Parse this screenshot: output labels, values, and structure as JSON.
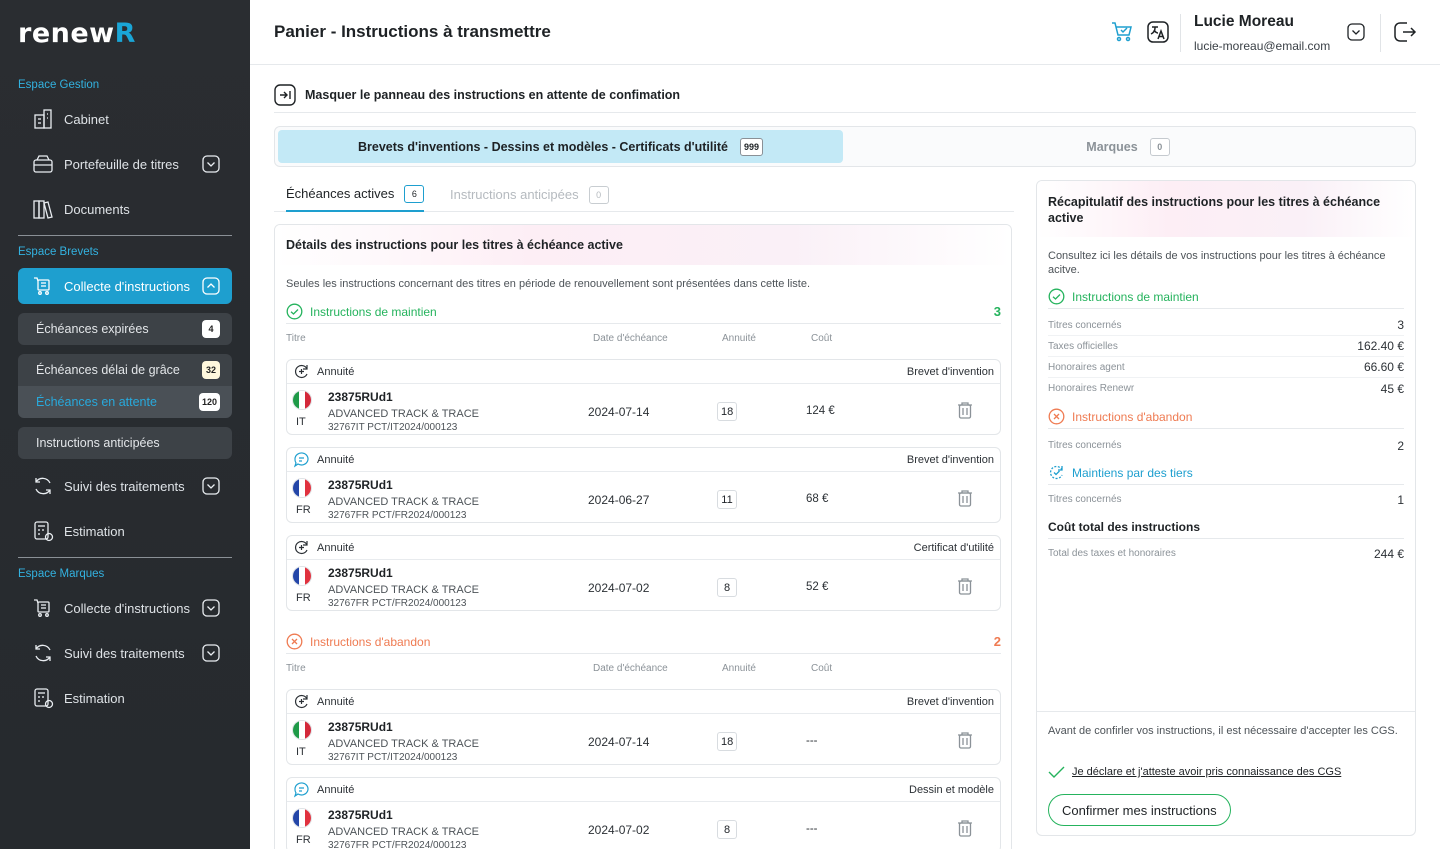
{
  "brand": {
    "logo_main": "renew",
    "logo_accent": "R"
  },
  "sidebar": {
    "gestion_label": "Espace Gestion",
    "gestion_items": [
      "Cabinet",
      "Portefeuille de titres",
      "Documents"
    ],
    "brevets_label": "Espace Brevets",
    "brevets_collecte": "Collecte d'instructions",
    "sub_items": [
      {
        "label": "Échéances expirées",
        "count": "4"
      },
      {
        "label": "Échéances délai de grâce",
        "count": "32"
      },
      {
        "label": "Échéances en attente",
        "count": "120"
      },
      {
        "label": "Instructions anticipées",
        "count": ""
      }
    ],
    "brevets_suivi": "Suivi des traitements",
    "brevets_estimation": "Estimation",
    "marques_label": "Espace Marques",
    "marques_items": [
      "Collecte d'instructions",
      "Suivi des traitements",
      "Estimation"
    ]
  },
  "header": {
    "title": "Panier - Instructions à transmettre",
    "user_name": "Lucie Moreau",
    "user_email": "lucie-moreau@email.com"
  },
  "toggle": {
    "label": "Masquer le panneau des instructions en attente de confimation"
  },
  "segments": [
    {
      "label": "Brevets d'inventions - Dessins et modèles - Certificats d'utilité",
      "count": "999"
    },
    {
      "label": "Marques",
      "count": "0"
    }
  ],
  "tabs": [
    {
      "label": "Échéances actives",
      "count": "6"
    },
    {
      "label": "Instructions anticipées",
      "count": "0"
    }
  ],
  "details": {
    "title": "Détails des instructions pour les titres à échéance active",
    "note": "Seules les instructions concernant des titres en période de renouvellement sont présentées dans cette liste.",
    "columns": {
      "titre": "Titre",
      "date": "Date d'échéance",
      "annuite": "Annuité",
      "cout": "Coût"
    },
    "maintien": {
      "title": "Instructions de maintien",
      "count": "3",
      "items": [
        {
          "annuity": "Annuité",
          "type": "Brevet d'invention",
          "ref": "23875RUd1",
          "desc": "ADVANCED TRACK & TRACE",
          "num": "32767IT   PCT/IT2024/000123",
          "cc": "IT",
          "date": "2024-07-14",
          "annuite": "18",
          "cost": "124 €"
        },
        {
          "annuity": "Annuité",
          "type": "Brevet d'invention",
          "ref": "23875RUd1",
          "desc": "ADVANCED TRACK & TRACE",
          "num": "32767FR   PCT/FR2024/000123",
          "cc": "FR",
          "date": "2024-06-27",
          "annuite": "11",
          "cost": "68 €"
        },
        {
          "annuity": "Annuité",
          "type": "Certificat d'utilité",
          "ref": "23875RUd1",
          "desc": "ADVANCED TRACK & TRACE",
          "num": "32767FR   PCT/FR2024/000123",
          "cc": "FR",
          "date": "2024-07-02",
          "annuite": "8",
          "cost": "52 €"
        }
      ]
    },
    "abandon": {
      "title": "Instructions d'abandon",
      "count": "2",
      "items": [
        {
          "annuity": "Annuité",
          "type": "Brevet d'invention",
          "ref": "23875RUd1",
          "desc": "ADVANCED TRACK & TRACE",
          "num": "32767IT   PCT/IT2024/000123",
          "cc": "IT",
          "date": "2024-07-14",
          "annuite": "18",
          "cost": "---"
        },
        {
          "annuity": "Annuité",
          "type": "Dessin et modèle",
          "ref": "23875RUd1",
          "desc": "ADVANCED TRACK & TRACE",
          "num": "32767FR   PCT/FR2024/000123",
          "cc": "FR",
          "date": "2024-07-02",
          "annuite": "8",
          "cost": "---"
        }
      ]
    }
  },
  "summary": {
    "title": "Récapitulatif des instructions pour les titres à échéance active",
    "note": "Consultez ici les détails de vos instructions pour les titres à échéance acitve.",
    "maintien_title": "Instructions de maintien",
    "maintien_rows": [
      {
        "k": "Titres concernés",
        "v": "3"
      },
      {
        "k": "Taxes officielles",
        "v": "162.40 €"
      },
      {
        "k": "Honoraires agent",
        "v": "66.60 €"
      },
      {
        "k": "Honoraires Renewr",
        "v": "45 €"
      }
    ],
    "abandon_title": "Instructions d'abandon",
    "abandon_rows": [
      {
        "k": "Titres concernés",
        "v": "2"
      }
    ],
    "tiers_title": "Maintiens par des tiers",
    "tiers_rows": [
      {
        "k": "Titres concernés",
        "v": "1"
      }
    ],
    "total_title": "Coût total des instructions",
    "total_row": {
      "k": "Total des taxes et honoraires",
      "v": "244 €"
    },
    "cgs_message": "Avant de confirler vos instructions, il est nécessaire d'accepter les CGS.",
    "cgs_check": "Je déclare et j'atteste avoir pris connaissance des CGS",
    "confirm_label": "Confirmer mes instructions"
  },
  "colors": {
    "accent": "#1e9fcf",
    "green": "#25b35d",
    "orange": "#ef7b52",
    "sidebar": "#2a2d31"
  },
  "flags": {
    "IT": [
      "#1f9a48",
      "#ffffff",
      "#d3283a"
    ],
    "FR": [
      "#2446a8",
      "#ffffff",
      "#e0313e"
    ]
  }
}
